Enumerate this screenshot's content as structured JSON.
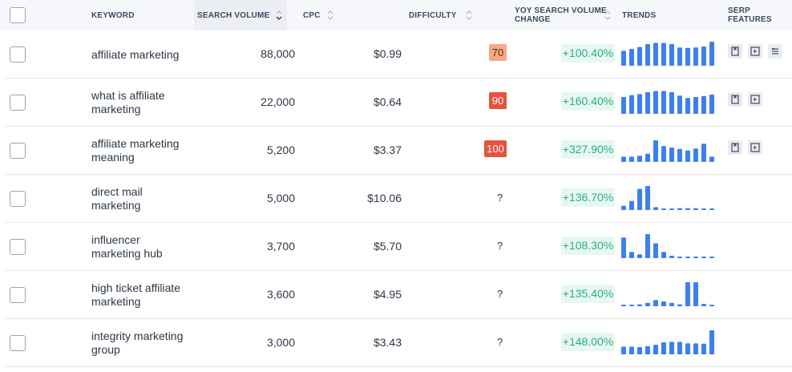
{
  "header": {
    "keyword": "KEYWORD",
    "search_volume": "SEARCH VOLUME",
    "cpc": "CPC",
    "difficulty": "DIFFICULTY",
    "yoy_line1": "YOY SEARCH VOLUME",
    "yoy_line2": "CHANGE",
    "trends": "TRENDS",
    "serp_features": "SERP FEATURES"
  },
  "colors": {
    "accent_blue": "#3b7ff1",
    "diff_orange": "#f6a881",
    "diff_red": "#e5533d",
    "yoy_green": "#27b083"
  },
  "rows": [
    {
      "keyword_line1": "affiliate marketing",
      "keyword_line2": "",
      "volume": "88,000",
      "cpc": "$0.99",
      "difficulty": "70",
      "difficulty_level": "orange",
      "yoy": "+100.40%",
      "trend": [
        0.62,
        0.7,
        0.78,
        0.9,
        0.95,
        0.95,
        0.9,
        0.76,
        0.74,
        0.76,
        0.8,
        1.0
      ],
      "serp": [
        "bookmark-icon",
        "video-icon",
        "list-icon"
      ]
    },
    {
      "keyword_line1": "what is affiliate",
      "keyword_line2": "marketing",
      "volume": "22,000",
      "cpc": "$0.64",
      "difficulty": "90",
      "difficulty_level": "red",
      "yoy": "+160.40%",
      "trend": [
        0.7,
        0.78,
        0.82,
        0.9,
        0.95,
        0.95,
        0.9,
        0.76,
        0.66,
        0.7,
        0.74,
        0.8
      ],
      "serp": [
        "bookmark-icon",
        "video-icon"
      ]
    },
    {
      "keyword_line1": "affiliate marketing",
      "keyword_line2": "meaning",
      "volume": "5,200",
      "cpc": "$3.37",
      "difficulty": "100",
      "difficulty_level": "red",
      "yoy": "+327.90%",
      "trend": [
        0.22,
        0.22,
        0.26,
        0.34,
        0.9,
        0.66,
        0.6,
        0.54,
        0.48,
        0.56,
        0.76,
        0.22
      ],
      "serp": [
        "bookmark-icon",
        "video-icon"
      ]
    },
    {
      "keyword_line1": "direct mail",
      "keyword_line2": "marketing",
      "volume": "5,000",
      "cpc": "$10.06",
      "difficulty": "?",
      "difficulty_level": "none",
      "yoy": "+136.70%",
      "trend": [
        0.18,
        0.38,
        0.88,
        1.0,
        0.12,
        0.06,
        0.06,
        0.08,
        0.08,
        0.08,
        0.06,
        0.06
      ],
      "serp": []
    },
    {
      "keyword_line1": "influencer",
      "keyword_line2": "marketing hub",
      "volume": "3,700",
      "cpc": "$5.70",
      "difficulty": "?",
      "difficulty_level": "none",
      "yoy": "+108.30%",
      "trend": [
        0.86,
        0.26,
        0.16,
        1.0,
        0.62,
        0.26,
        0.1,
        0.06,
        0.06,
        0.06,
        0.06,
        0.06
      ],
      "serp": []
    },
    {
      "keyword_line1": "high ticket affiliate",
      "keyword_line2": "marketing",
      "volume": "3,600",
      "cpc": "$4.95",
      "difficulty": "?",
      "difficulty_level": "none",
      "yoy": "+135.40%",
      "trend": [
        0.04,
        0.04,
        0.08,
        0.14,
        0.26,
        0.2,
        0.14,
        0.08,
        1.0,
        1.0,
        0.1,
        0.04
      ],
      "serp": []
    },
    {
      "keyword_line1": "integrity marketing",
      "keyword_line2": "group",
      "volume": "3,000",
      "cpc": "$3.43",
      "difficulty": "?",
      "difficulty_level": "none",
      "yoy": "+148.00%",
      "trend": [
        0.32,
        0.32,
        0.3,
        0.34,
        0.4,
        0.5,
        0.52,
        0.52,
        0.46,
        0.46,
        0.44,
        1.0
      ],
      "serp": []
    }
  ]
}
